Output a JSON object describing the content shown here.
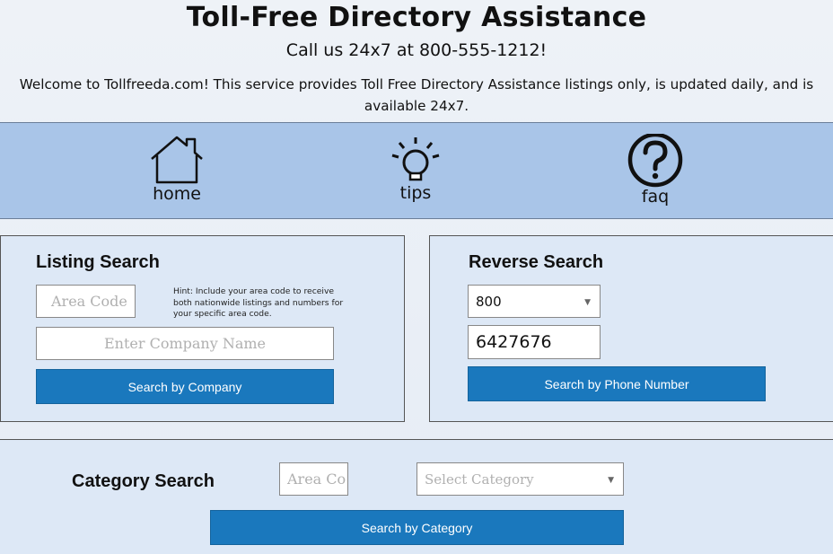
{
  "header": {
    "title": "Toll-Free Directory Assistance",
    "subtitle": "Call us 24x7 at 800-555-1212!",
    "welcome": "Welcome to Tollfreeda.com! This service provides Toll Free Directory Assistance listings only, is updated daily, and is available 24x7."
  },
  "nav": {
    "items": [
      {
        "label": "home",
        "icon": "house-icon"
      },
      {
        "label": "tips",
        "icon": "lightbulb-icon"
      },
      {
        "label": "faq",
        "icon": "question-circle-icon"
      }
    ]
  },
  "listing_search": {
    "title": "Listing Search",
    "area_code_placeholder": "Area Code",
    "hint": "Hint: Include your area code to receive both nationwide listings and numbers for your specific area code.",
    "company_placeholder": "Enter Company Name",
    "button_label": "Search by Company"
  },
  "reverse_search": {
    "title": "Reverse Search",
    "prefix_value": "800",
    "number_value": "6427676",
    "button_label": "Search by Phone Number"
  },
  "category_search": {
    "title": "Category Search",
    "area_code_placeholder": "Area Co",
    "category_placeholder": "Select Category",
    "button_label": "Search by Category"
  },
  "colors": {
    "nav_bg": "#a9c5e8",
    "panel_bg": "#dde8f6",
    "button": "#1a78bd"
  }
}
